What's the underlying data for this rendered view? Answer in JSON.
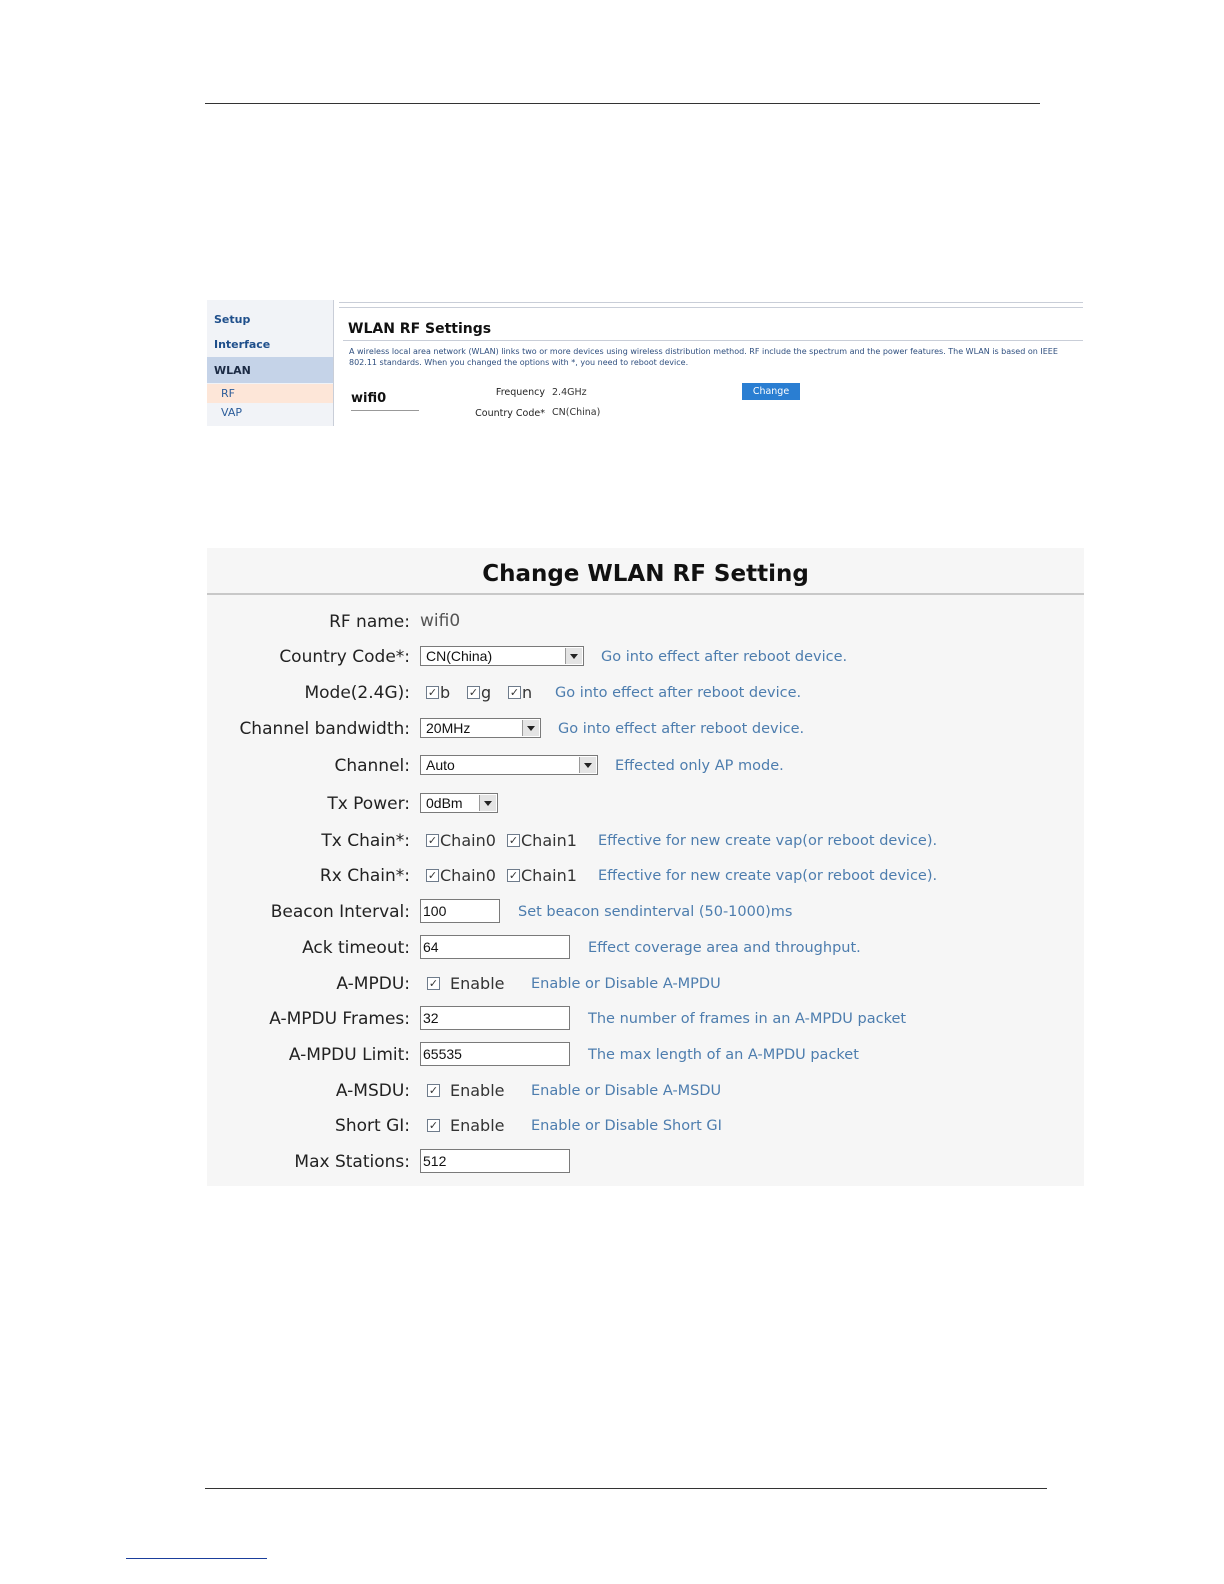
{
  "screenshot1": {
    "sidebar": {
      "setup": "Setup",
      "interface": "Interface",
      "wlan": "WLAN",
      "rf": "RF",
      "vap": "VAP"
    },
    "title": "WLAN RF Settings",
    "description": "A wireless local area network (WLAN) links two or more devices using wireless distribution method. RF include the spectrum and the power features. The WLAN is based on IEEE 802.11 standards. When you changed the options with *, you need to reboot device.",
    "rf_name": "wifi0",
    "frequency_label": "Frequency",
    "frequency_value": "2.4GHz",
    "country_code_label": "Country Code*",
    "country_code_value": "CN(China)",
    "change_button": "Change"
  },
  "screenshot2": {
    "title": "Change WLAN RF Setting",
    "rf_name": {
      "label": "RF name:",
      "value": "wifi0"
    },
    "country_code": {
      "label": "Country Code*:",
      "value": "CN(China)",
      "hint": "Go into effect after reboot device."
    },
    "mode": {
      "label": "Mode(2.4G):",
      "opt_b": "b",
      "opt_g": "g",
      "opt_n": "n",
      "hint": "Go into effect after reboot device."
    },
    "channel_bandwidth": {
      "label": "Channel bandwidth:",
      "value": "20MHz",
      "hint": "Go into effect after reboot device."
    },
    "channel": {
      "label": "Channel:",
      "value": "Auto",
      "hint": "Effected only AP mode."
    },
    "tx_power": {
      "label": "Tx Power:",
      "value": "0dBm"
    },
    "tx_chain": {
      "label": "Tx Chain*:",
      "chain0": "Chain0",
      "chain1": "Chain1",
      "hint": "Effective for new create vap(or reboot device)."
    },
    "rx_chain": {
      "label": "Rx Chain*:",
      "chain0": "Chain0",
      "chain1": "Chain1",
      "hint": "Effective for new create vap(or reboot device)."
    },
    "beacon_interval": {
      "label": "Beacon Interval:",
      "value": "100",
      "hint": "Set beacon sendinterval (50-1000)ms"
    },
    "ack_timeout": {
      "label": "Ack timeout:",
      "value": "64",
      "hint": "Effect coverage area and throughput."
    },
    "ampdu": {
      "label": "A-MPDU:",
      "enable": "Enable",
      "hint": "Enable or Disable A-MPDU"
    },
    "ampdu_frames": {
      "label": "A-MPDU Frames:",
      "value": "32",
      "hint": "The number of frames in an A-MPDU packet"
    },
    "ampdu_limit": {
      "label": "A-MPDU Limit:",
      "value": "65535",
      "hint": "The max length of an A-MPDU packet"
    },
    "amsdu": {
      "label": "A-MSDU:",
      "enable": "Enable",
      "hint": "Enable or Disable A-MSDU"
    },
    "short_gi": {
      "label": "Short GI:",
      "enable": "Enable",
      "hint": "Enable or Disable Short GI"
    },
    "max_stations": {
      "label": "Max Stations:",
      "value": "512"
    },
    "checkbox_mark": "✓"
  }
}
